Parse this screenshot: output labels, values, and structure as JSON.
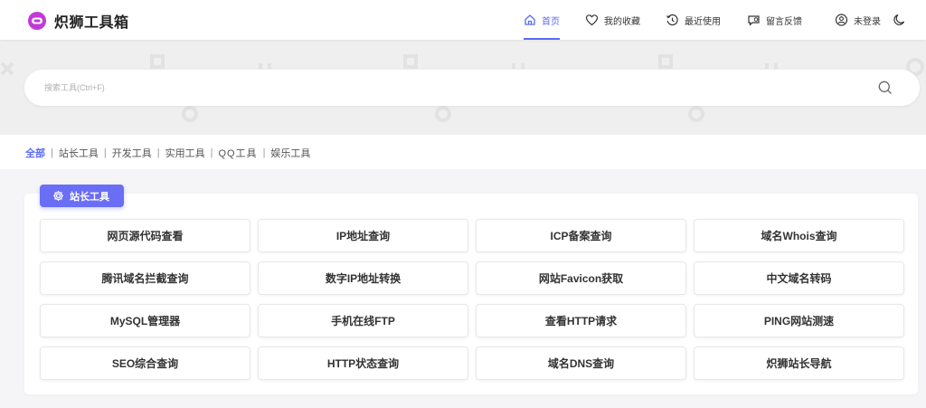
{
  "brand": {
    "name": "炽狮工具箱",
    "icon": "lion-logo-icon",
    "color": "#c23ad6"
  },
  "nav": {
    "items": [
      {
        "label": "首页",
        "icon": "home-icon",
        "active": true
      },
      {
        "label": "我的收藏",
        "icon": "heart-icon"
      },
      {
        "label": "最近使用",
        "icon": "history-icon"
      },
      {
        "label": "留言反馈",
        "icon": "message-icon"
      },
      {
        "label": "未登录",
        "icon": "user-icon"
      }
    ],
    "theme_toggle_icon": "moon-icon",
    "accent": "#5b6bf3"
  },
  "search": {
    "placeholder": "搜索工具(Ctrl+F)",
    "value": "",
    "icon": "search-icon"
  },
  "filters": {
    "tabs": [
      "全部",
      "站长工具",
      "开发工具",
      "实用工具",
      "QQ工具",
      "娱乐工具"
    ],
    "active_index": 0
  },
  "category": {
    "title": "站长工具",
    "icon": "gear-icon",
    "color": "#6a6ef5",
    "tools": [
      "网页源代码查看",
      "IP地址查询",
      "ICP备案查询",
      "域名Whois查询",
      "腾讯域名拦截查询",
      "数字IP地址转换",
      "网站Favicon获取",
      "中文域名转码",
      "MySQL管理器",
      "手机在线FTP",
      "查看HTTP请求",
      "PING网站测速",
      "SEO综合查询",
      "HTTP状态查询",
      "域名DNS查询",
      "炽狮站长导航"
    ]
  }
}
